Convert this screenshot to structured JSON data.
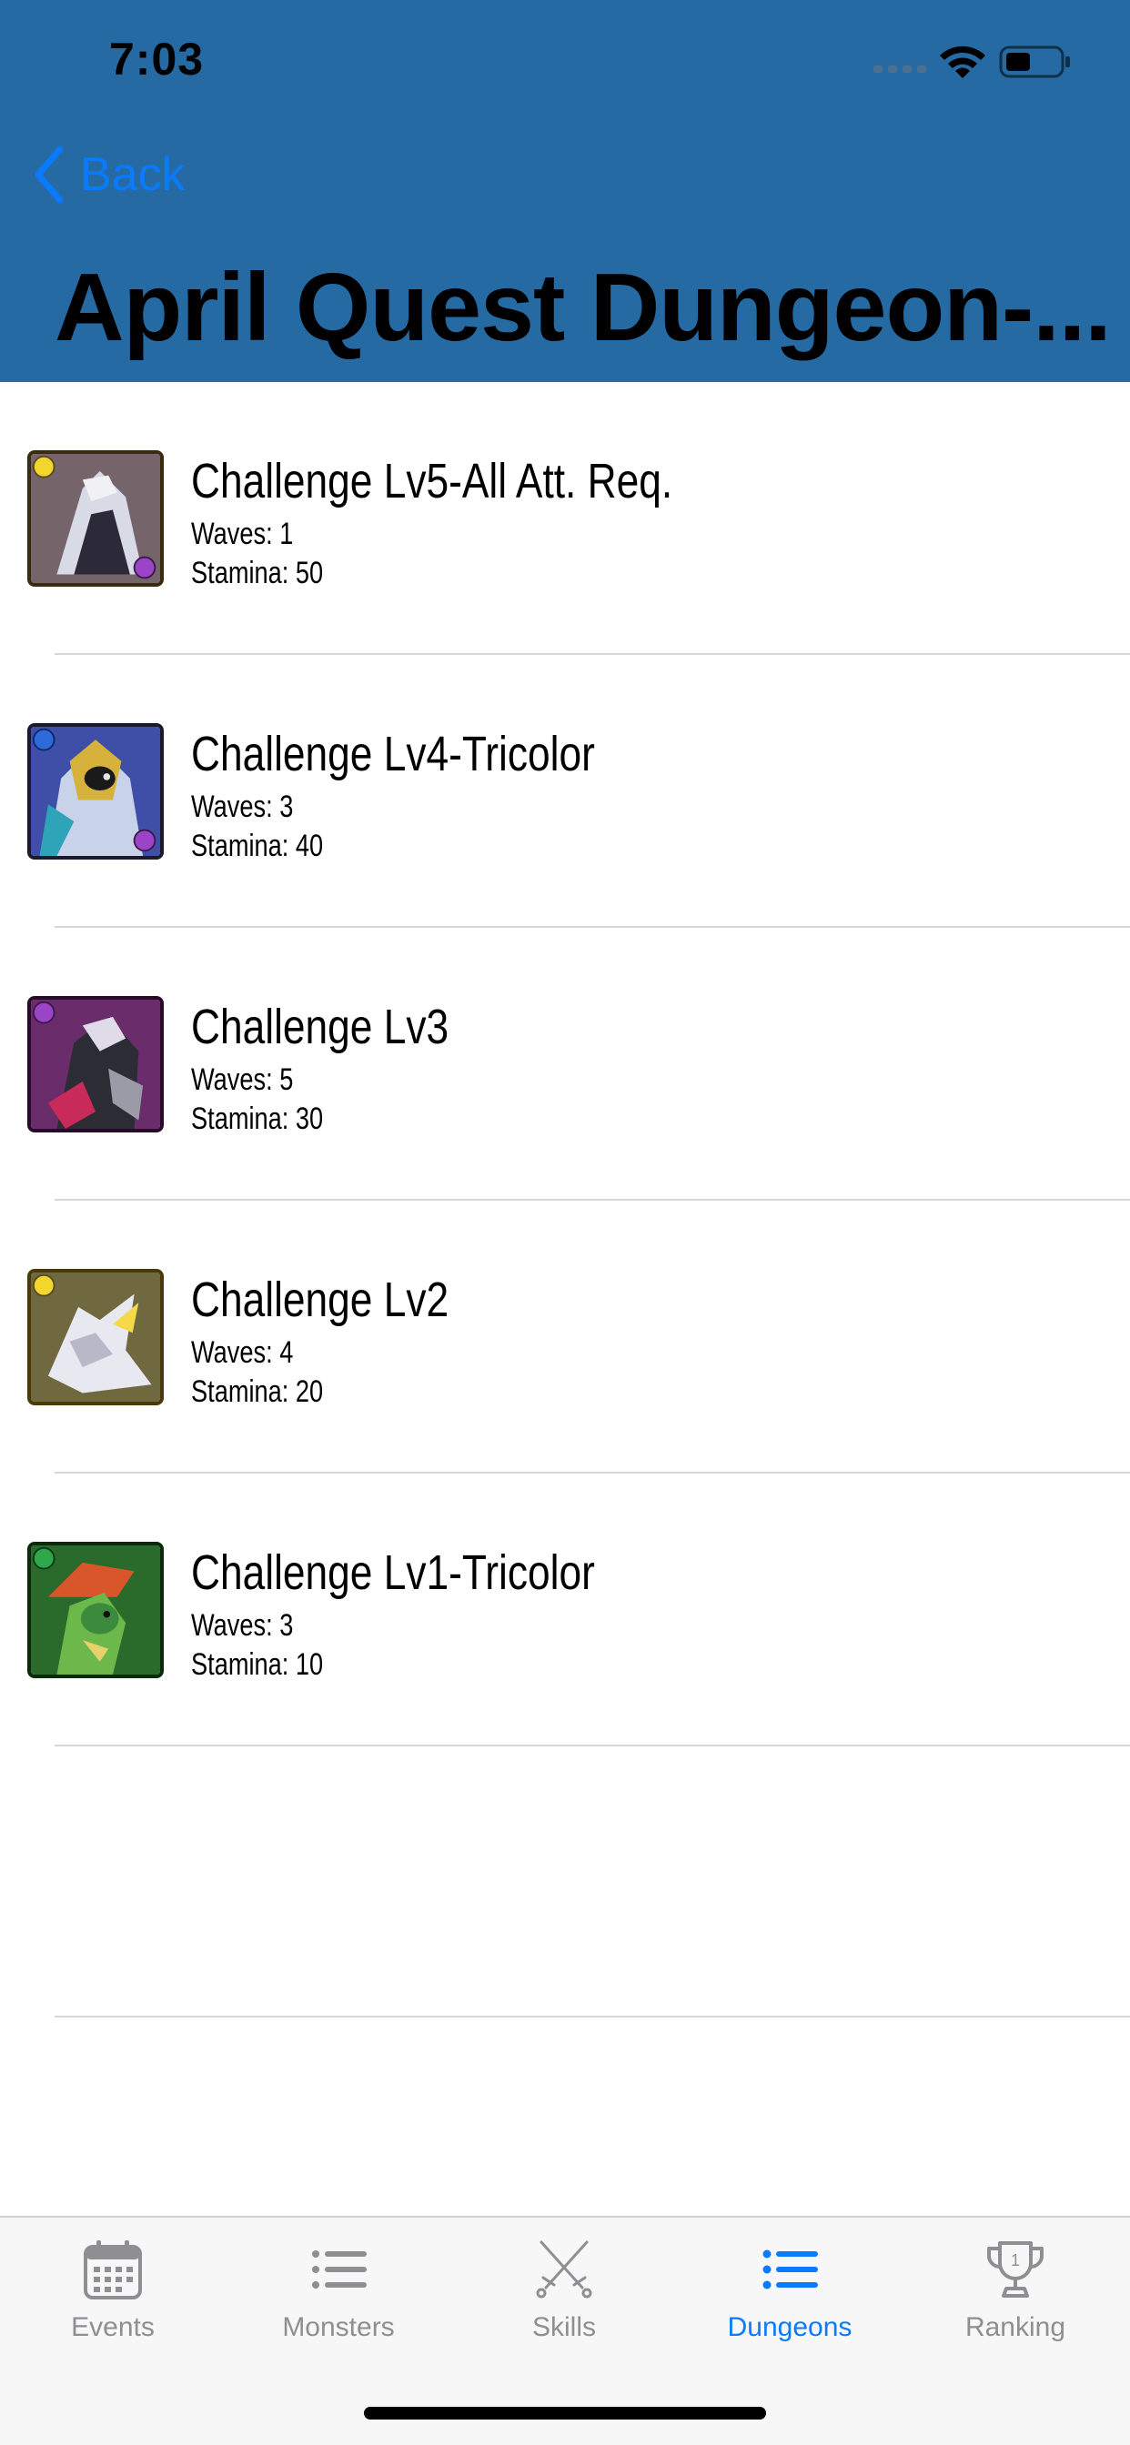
{
  "status_bar": {
    "time": "7:03"
  },
  "nav": {
    "back_label": "Back",
    "title": "April Quest Dungeon-..."
  },
  "colors": {
    "header_bg": "#256aa3",
    "accent": "#0a7aff"
  },
  "dungeons": [
    {
      "title": "Challenge Lv5-All Att. Req.",
      "waves": "Waves: 1",
      "stamina": "Stamina: 50",
      "icon": "monster-thumbnail-dark-knight"
    },
    {
      "title": "Challenge Lv4-Tricolor",
      "waves": "Waves: 3",
      "stamina": "Stamina: 40",
      "icon": "monster-thumbnail-gold-mask"
    },
    {
      "title": "Challenge Lv3",
      "waves": "Waves: 5",
      "stamina": "Stamina: 30",
      "icon": "monster-thumbnail-dark-mech"
    },
    {
      "title": "Challenge Lv2",
      "waves": "Waves: 4",
      "stamina": "Stamina: 20",
      "icon": "monster-thumbnail-white-dragon"
    },
    {
      "title": "Challenge Lv1-Tricolor",
      "waves": "Waves: 3",
      "stamina": "Stamina: 10",
      "icon": "monster-thumbnail-green-dragon"
    }
  ],
  "tabbar": {
    "events": "Events",
    "monsters": "Monsters",
    "skills": "Skills",
    "dungeons": "Dungeons",
    "ranking": "Ranking",
    "ranking_badge": "1",
    "active": "dungeons"
  }
}
